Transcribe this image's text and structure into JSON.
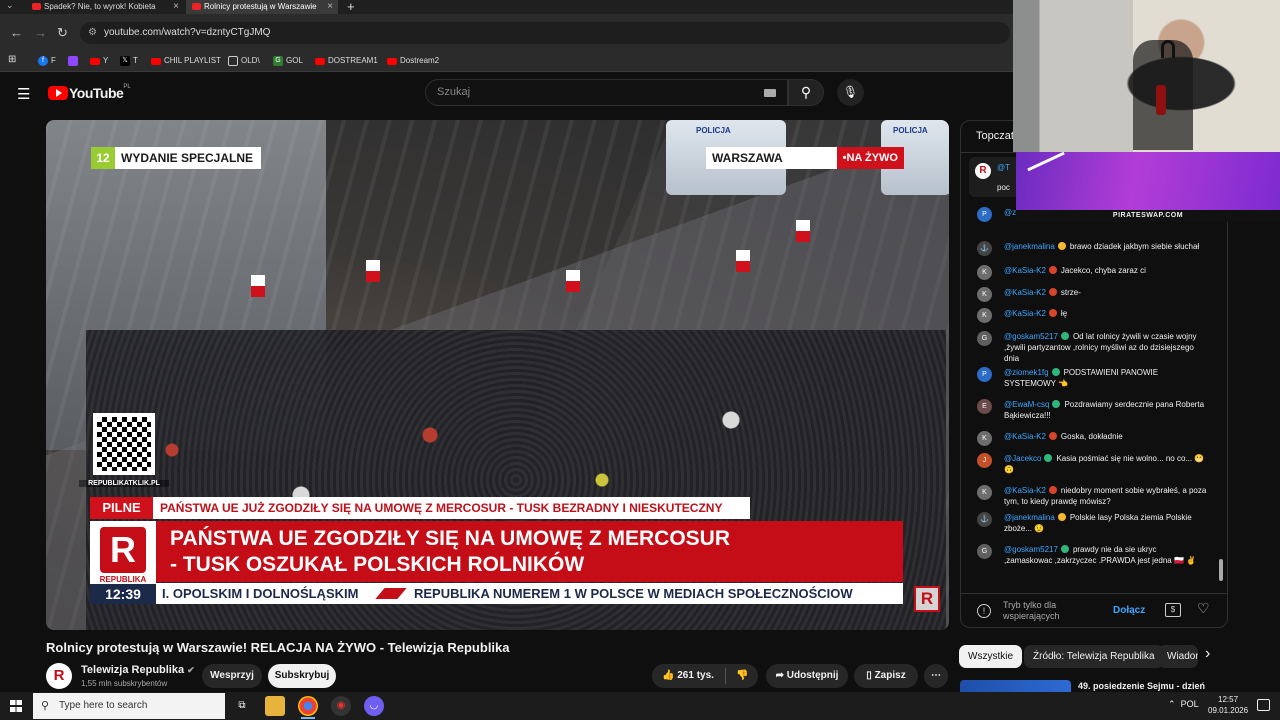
{
  "browser": {
    "tabs": [
      {
        "label": "Spadek? Nie, to wyrok! Kobieta"
      },
      {
        "label": "Rolnicy protestują w Warszawie"
      }
    ],
    "url": "youtube.com/watch?v=dzntyCTgJMQ",
    "bookmarks": [
      {
        "label": "F",
        "icon": "facebook-icon",
        "color": "#1877f2"
      },
      {
        "label": "",
        "icon": "twitch-icon",
        "color": "#9146ff"
      },
      {
        "label": "Y",
        "icon": "youtube-icon",
        "color": "#ff0000"
      },
      {
        "label": "T",
        "icon": "x-icon",
        "color": "#000000"
      },
      {
        "label": "CHIL PLAYLIST",
        "icon": "youtube-icon",
        "color": "#ff0000"
      },
      {
        "label": "OLD\\",
        "icon": "folder-icon",
        "color": "#444444"
      },
      {
        "label": "GOL",
        "icon": "gol-icon",
        "color": "#2e7d32"
      },
      {
        "label": "DOSTREAM1",
        "icon": "youtube-icon",
        "color": "#ff0000"
      },
      {
        "label": "Dostream2",
        "icon": "youtube-icon",
        "color": "#ff0000"
      }
    ]
  },
  "youtube": {
    "logo_text": "YouTube",
    "logo_country": "PL",
    "search_placeholder": "Szukaj"
  },
  "video": {
    "tag_number": "12",
    "tag_label": "WYDANIE SPECJALNE",
    "location": "WARSZAWA",
    "live_label": "•NA ŻYWO",
    "police_label": "POLICJA",
    "qr_caption": "REPUBLIKATKLIK.PL",
    "ticker_label": "PILNE",
    "ticker_text": "PAŃSTWA UE JUŻ ZGODZIŁY SIĘ NA UMOWĘ Z MERCOSUR - TUSK BEZRADNY I NIESKUTECZNY",
    "headline_line1": "PAŃSTWA UE ZGODZIŁY SIĘ NA UMOWĘ Z MERCOSUR",
    "headline_line2": "- TUSK OSZUKAŁ POLSKICH ROLNIKÓW",
    "logo_letter": "R",
    "logo_name": "REPUBLIKA",
    "clock": "12:39",
    "crawl_left": "I. OPOLSKIM I DOLNOŚLĄSKIM",
    "crawl_right": "REPUBLIKA NUMEREM 1 W POLSCE W MEDIACH SPOŁECZNOŚCIOW"
  },
  "meta": {
    "title": "Rolnicy protestują w Warszawie! RELACJA NA ŻYWO - Telewizja Republika",
    "channel_name": "Telewizja Republika",
    "subscribers": "1,55 mln subskrybentów",
    "support_label": "Wesprzyj",
    "subscribe_label": "Subskrybuj",
    "likes": "261 tys.",
    "share_label": "Udostępnij",
    "save_label": "Zapisz"
  },
  "chat": {
    "header": "Topczat",
    "pinned_author": "@T",
    "pinned_text": "poc",
    "messages": [
      {
        "author": "@z",
        "text": "👍",
        "initial": "P",
        "color": "#2c6bc6",
        "badge": ""
      },
      {
        "author": "@janekmalina",
        "text": "brawo dziadek jakbym siebie słuchał",
        "initial": "⚓",
        "color": "#444444",
        "badge": "#f5b82e"
      },
      {
        "author": "@KaSia-K2",
        "text": "Jacekco, chyba zaraz ci",
        "initial": "K",
        "color": "#6d6d6d",
        "badge": "#d9442a"
      },
      {
        "author": "@KaSia-K2",
        "text": "strze-",
        "initial": "K",
        "color": "#6d6d6d",
        "badge": "#d9442a"
      },
      {
        "author": "@KaSia-K2",
        "text": "łę",
        "initial": "K",
        "color": "#6d6d6d",
        "badge": "#d9442a"
      },
      {
        "author": "@goskam5217",
        "text": "Od lat rolnicy żywili w czasie wojny ,żywili partyzantow ,rolnicy myśliwi az do dzisiejszego dnia",
        "initial": "G",
        "color": "#5f5f5f",
        "badge": "#2fb67c"
      },
      {
        "author": "@ziomek1fg",
        "text": "PODSTAWIENI PANOWIE SYSTEMOWY 👈",
        "initial": "P",
        "color": "#2c6bc6",
        "badge": "#2fb67c"
      },
      {
        "author": "@EwaM-csq",
        "text": "Pozdrawiamy serdecznie pana Roberta Bąkiewicza!!!",
        "initial": "E",
        "color": "#6b4b4b",
        "badge": "#2fb67c"
      },
      {
        "author": "@KaSia-K2",
        "text": "Goska, dokładnie",
        "initial": "K",
        "color": "#6d6d6d",
        "badge": "#d9442a"
      },
      {
        "author": "@Jacekco",
        "text": "Kasia pośmiać się nie wolno... no co... 😬 🙃",
        "initial": "J",
        "color": "#c4502a",
        "badge": "#2fb67c"
      },
      {
        "author": "@KaSia-K2",
        "text": "niedobry moment sobie wybrałeś, a poza tym, to kiedy prawdę mówisz?",
        "initial": "K",
        "color": "#6d6d6d",
        "badge": "#d9442a"
      },
      {
        "author": "@janekmalina",
        "text": "Polskie lasy Polska ziemia Polskie zboże... 😟",
        "initial": "⚓",
        "color": "#444444",
        "badge": "#f5b82e"
      },
      {
        "author": "@goskam5217",
        "text": "prawdy nie da sie ukryc ,zamaskowac ,zakrzyczec .PRAWDA jest jedna 🇵🇱 ✌",
        "initial": "G",
        "color": "#5f5f5f",
        "badge": "#2fb67c"
      }
    ],
    "footer_note": "Tryb tylko dla wspierających",
    "join_label": "Dołącz"
  },
  "chips": [
    "Wszystkie",
    "Źródło: Telewizja Republika",
    "Wiadomości"
  ],
  "recommendation": {
    "title": "49. posiedzenie Sejmu - dzień"
  },
  "overlay": {
    "banner_text": "PIRATESWAP.COM"
  },
  "taskbar": {
    "search_placeholder": "Type here to search",
    "language": "POL",
    "time": "12:57",
    "date": "09.01.2026"
  }
}
